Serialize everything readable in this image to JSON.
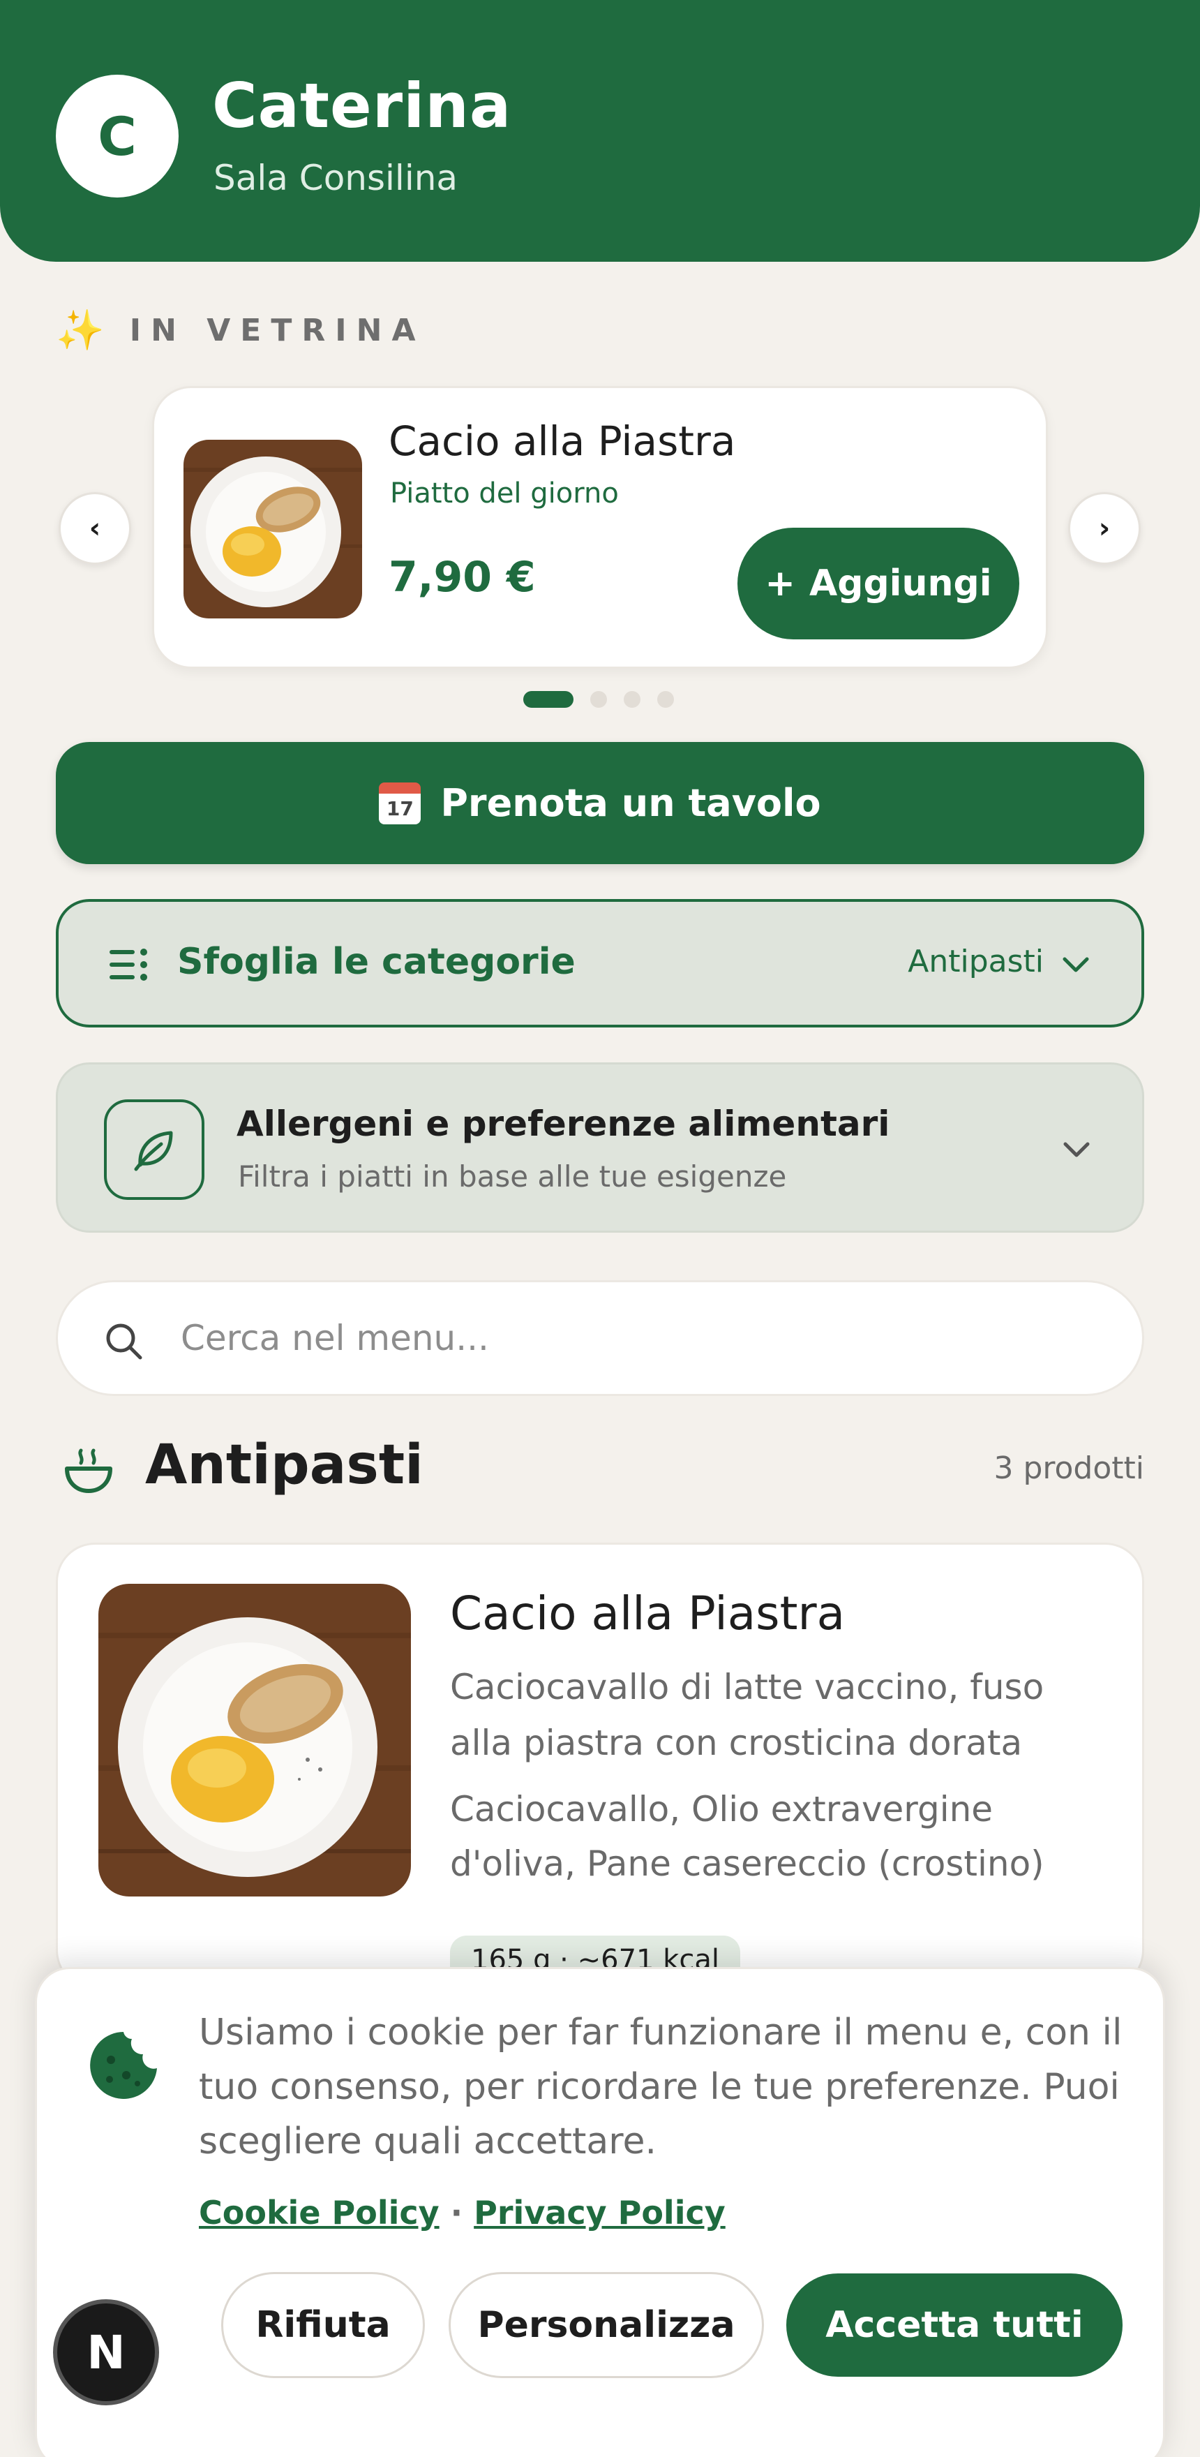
{
  "header": {
    "avatar_letter": "C",
    "name": "Caterina",
    "city": "Sala Consilina"
  },
  "vetrina": {
    "label": "IN VETRINA",
    "prev_label": "‹",
    "next_label": "›",
    "item": {
      "title": "Cacio alla Piastra",
      "subtitle": "Piatto del giorno",
      "price": "7,90 €",
      "add_label": "Aggiungi",
      "add_symbol": "+"
    },
    "dots_total": 4,
    "active_dot": 1
  },
  "booking": {
    "calendar_day": "17",
    "label": "Prenota un tavolo"
  },
  "categories": {
    "label": "Sfoglia le categorie",
    "current": "Antipasti"
  },
  "allergens": {
    "title": "Allergeni e preferenze alimentari",
    "subtitle": "Filtra i piatti in base alle tue esigenze"
  },
  "search": {
    "placeholder": "Cerca nel menu...",
    "value": ""
  },
  "section": {
    "title": "Antipasti",
    "count": "3 prodotti"
  },
  "product": {
    "title": "Cacio alla Piastra",
    "description": "Caciocavallo di latte vaccino, fuso alla piastra con crosticina dorata",
    "ingredients": "Caciocavallo, Olio extravergine d'oliva, Pane casereccio (crostino)",
    "badge": "165 g · ~671 kcal"
  },
  "cookie": {
    "text": "Usiamo i cookie per far funzionare il menu e, con il tuo consenso, per ricordare le tue preferenze. Puoi scegliere quali accettare.",
    "cookie_policy": "Cookie Policy",
    "separator": "·",
    "privacy_policy": "Privacy Policy",
    "reject": "Rifiuta",
    "customize": "Personalizza",
    "accept": "Accetta tutti"
  },
  "dev_badge": "N",
  "colors": {
    "brand": "#1f6b3f",
    "background": "#f4f1ec",
    "panel": "#dfe4dc"
  }
}
